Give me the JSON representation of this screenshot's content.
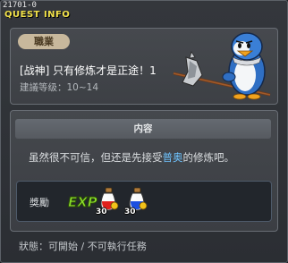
{
  "window": {
    "id_label": "21701-0",
    "title": "QUEST INFO",
    "close_label": "×"
  },
  "quest": {
    "job_badge": "職業",
    "name": "[战神] 只有修炼才是正途！1",
    "level_requirement": "建議等级：10~14"
  },
  "content": {
    "header": "内容",
    "text_before": "虽然很不可信，但还是先接受",
    "text_highlight": "普奥",
    "text_after": "的修炼吧。"
  },
  "reward": {
    "label": "獎勵",
    "exp_icon": "EXP",
    "items": [
      {
        "icon": "red-potion-icon",
        "count": "30"
      },
      {
        "icon": "blue-potion-icon",
        "count": "30"
      }
    ]
  },
  "status": {
    "text": "狀態：可開始 / 不可執行任務"
  },
  "colors": {
    "title_yellow": "#f2e24a",
    "highlight_blue": "#6fc3ff",
    "exp_green": "#8de02c"
  }
}
